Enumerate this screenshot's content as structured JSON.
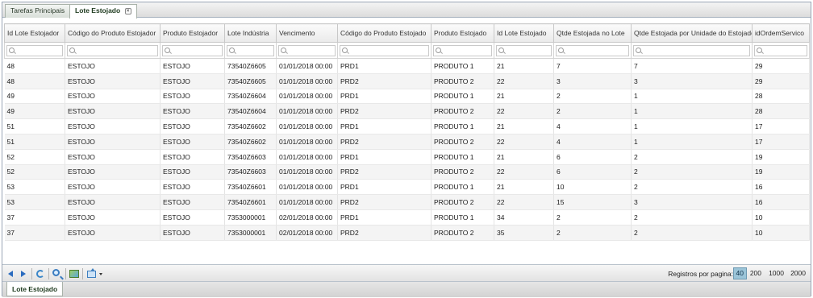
{
  "tabs": [
    {
      "label": "Tarefas Principais"
    },
    {
      "label": "Lote Estojado",
      "close": "×"
    }
  ],
  "columns": [
    "Id Lote Estojador",
    "Código do Produto Estojador",
    "Produto Estojador",
    "Lote Indústria",
    "Vencimento",
    "Código do Produto Estojado",
    "Produto Estojado",
    "Id Lote Estojado",
    "Qtde Estojada no Lote",
    "Qtde Estojada por Unidade do Estojador",
    "idOrdemServico"
  ],
  "rows": [
    [
      "48",
      "ESTOJO",
      "ESTOJO",
      "73540Z6605",
      "01/01/2018 00:00",
      "PRD1",
      "PRODUTO 1",
      "21",
      "7",
      "7",
      "29"
    ],
    [
      "48",
      "ESTOJO",
      "ESTOJO",
      "73540Z6605",
      "01/01/2018 00:00",
      "PRD2",
      "PRODUTO 2",
      "22",
      "3",
      "3",
      "29"
    ],
    [
      "49",
      "ESTOJO",
      "ESTOJO",
      "73540Z6604",
      "01/01/2018 00:00",
      "PRD1",
      "PRODUTO 1",
      "21",
      "2",
      "1",
      "28"
    ],
    [
      "49",
      "ESTOJO",
      "ESTOJO",
      "73540Z6604",
      "01/01/2018 00:00",
      "PRD2",
      "PRODUTO 2",
      "22",
      "2",
      "1",
      "28"
    ],
    [
      "51",
      "ESTOJO",
      "ESTOJO",
      "73540Z6602",
      "01/01/2018 00:00",
      "PRD1",
      "PRODUTO 1",
      "21",
      "4",
      "1",
      "17"
    ],
    [
      "51",
      "ESTOJO",
      "ESTOJO",
      "73540Z6602",
      "01/01/2018 00:00",
      "PRD2",
      "PRODUTO 2",
      "22",
      "4",
      "1",
      "17"
    ],
    [
      "52",
      "ESTOJO",
      "ESTOJO",
      "73540Z6603",
      "01/01/2018 00:00",
      "PRD1",
      "PRODUTO 1",
      "21",
      "6",
      "2",
      "19"
    ],
    [
      "52",
      "ESTOJO",
      "ESTOJO",
      "73540Z6603",
      "01/01/2018 00:00",
      "PRD2",
      "PRODUTO 2",
      "22",
      "6",
      "2",
      "19"
    ],
    [
      "53",
      "ESTOJO",
      "ESTOJO",
      "73540Z6601",
      "01/01/2018 00:00",
      "PRD1",
      "PRODUTO 1",
      "21",
      "10",
      "2",
      "16"
    ],
    [
      "53",
      "ESTOJO",
      "ESTOJO",
      "73540Z6601",
      "01/01/2018 00:00",
      "PRD2",
      "PRODUTO 2",
      "22",
      "15",
      "3",
      "16"
    ],
    [
      "37",
      "ESTOJO",
      "ESTOJO",
      "7353000001",
      "02/01/2018 00:00",
      "PRD1",
      "PRODUTO 1",
      "34",
      "2",
      "2",
      "10"
    ],
    [
      "37",
      "ESTOJO",
      "ESTOJO",
      "7353000001",
      "02/01/2018 00:00",
      "PRD2",
      "PRODUTO 2",
      "35",
      "2",
      "2",
      "10"
    ]
  ],
  "pager": {
    "label": "Registros por pagina:",
    "sizes": [
      "40",
      "200",
      "1000",
      "2000"
    ],
    "selected": "40"
  },
  "toolbar_icons": [
    "prev-page-icon",
    "next-page-icon",
    "refresh-icon",
    "search-icon",
    "chart-icon",
    "export-icon"
  ],
  "bottom_tab": "Lote Estojado"
}
